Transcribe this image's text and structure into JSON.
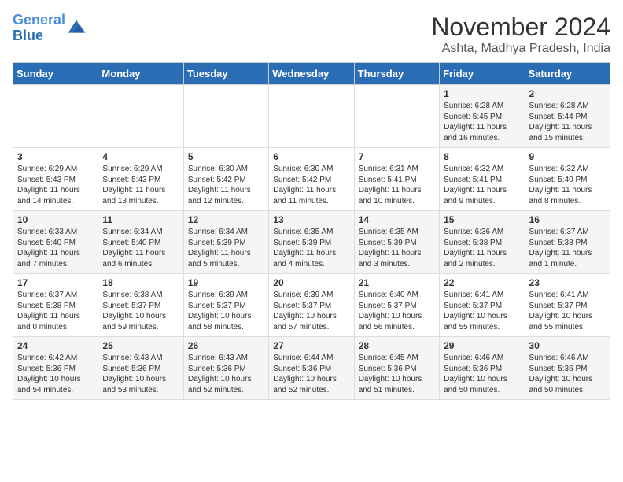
{
  "header": {
    "logo_line1": "General",
    "logo_line2": "Blue",
    "month_title": "November 2024",
    "location": "Ashta, Madhya Pradesh, India"
  },
  "days_of_week": [
    "Sunday",
    "Monday",
    "Tuesday",
    "Wednesday",
    "Thursday",
    "Friday",
    "Saturday"
  ],
  "weeks": [
    [
      {
        "day": "",
        "content": ""
      },
      {
        "day": "",
        "content": ""
      },
      {
        "day": "",
        "content": ""
      },
      {
        "day": "",
        "content": ""
      },
      {
        "day": "",
        "content": ""
      },
      {
        "day": "1",
        "content": "Sunrise: 6:28 AM\nSunset: 5:45 PM\nDaylight: 11 hours and 16 minutes."
      },
      {
        "day": "2",
        "content": "Sunrise: 6:28 AM\nSunset: 5:44 PM\nDaylight: 11 hours and 15 minutes."
      }
    ],
    [
      {
        "day": "3",
        "content": "Sunrise: 6:29 AM\nSunset: 5:43 PM\nDaylight: 11 hours and 14 minutes."
      },
      {
        "day": "4",
        "content": "Sunrise: 6:29 AM\nSunset: 5:43 PM\nDaylight: 11 hours and 13 minutes."
      },
      {
        "day": "5",
        "content": "Sunrise: 6:30 AM\nSunset: 5:42 PM\nDaylight: 11 hours and 12 minutes."
      },
      {
        "day": "6",
        "content": "Sunrise: 6:30 AM\nSunset: 5:42 PM\nDaylight: 11 hours and 11 minutes."
      },
      {
        "day": "7",
        "content": "Sunrise: 6:31 AM\nSunset: 5:41 PM\nDaylight: 11 hours and 10 minutes."
      },
      {
        "day": "8",
        "content": "Sunrise: 6:32 AM\nSunset: 5:41 PM\nDaylight: 11 hours and 9 minutes."
      },
      {
        "day": "9",
        "content": "Sunrise: 6:32 AM\nSunset: 5:40 PM\nDaylight: 11 hours and 8 minutes."
      }
    ],
    [
      {
        "day": "10",
        "content": "Sunrise: 6:33 AM\nSunset: 5:40 PM\nDaylight: 11 hours and 7 minutes."
      },
      {
        "day": "11",
        "content": "Sunrise: 6:34 AM\nSunset: 5:40 PM\nDaylight: 11 hours and 6 minutes."
      },
      {
        "day": "12",
        "content": "Sunrise: 6:34 AM\nSunset: 5:39 PM\nDaylight: 11 hours and 5 minutes."
      },
      {
        "day": "13",
        "content": "Sunrise: 6:35 AM\nSunset: 5:39 PM\nDaylight: 11 hours and 4 minutes."
      },
      {
        "day": "14",
        "content": "Sunrise: 6:35 AM\nSunset: 5:39 PM\nDaylight: 11 hours and 3 minutes."
      },
      {
        "day": "15",
        "content": "Sunrise: 6:36 AM\nSunset: 5:38 PM\nDaylight: 11 hours and 2 minutes."
      },
      {
        "day": "16",
        "content": "Sunrise: 6:37 AM\nSunset: 5:38 PM\nDaylight: 11 hours and 1 minute."
      }
    ],
    [
      {
        "day": "17",
        "content": "Sunrise: 6:37 AM\nSunset: 5:38 PM\nDaylight: 11 hours and 0 minutes."
      },
      {
        "day": "18",
        "content": "Sunrise: 6:38 AM\nSunset: 5:37 PM\nDaylight: 10 hours and 59 minutes."
      },
      {
        "day": "19",
        "content": "Sunrise: 6:39 AM\nSunset: 5:37 PM\nDaylight: 10 hours and 58 minutes."
      },
      {
        "day": "20",
        "content": "Sunrise: 6:39 AM\nSunset: 5:37 PM\nDaylight: 10 hours and 57 minutes."
      },
      {
        "day": "21",
        "content": "Sunrise: 6:40 AM\nSunset: 5:37 PM\nDaylight: 10 hours and 56 minutes."
      },
      {
        "day": "22",
        "content": "Sunrise: 6:41 AM\nSunset: 5:37 PM\nDaylight: 10 hours and 55 minutes."
      },
      {
        "day": "23",
        "content": "Sunrise: 6:41 AM\nSunset: 5:37 PM\nDaylight: 10 hours and 55 minutes."
      }
    ],
    [
      {
        "day": "24",
        "content": "Sunrise: 6:42 AM\nSunset: 5:36 PM\nDaylight: 10 hours and 54 minutes."
      },
      {
        "day": "25",
        "content": "Sunrise: 6:43 AM\nSunset: 5:36 PM\nDaylight: 10 hours and 53 minutes."
      },
      {
        "day": "26",
        "content": "Sunrise: 6:43 AM\nSunset: 5:36 PM\nDaylight: 10 hours and 52 minutes."
      },
      {
        "day": "27",
        "content": "Sunrise: 6:44 AM\nSunset: 5:36 PM\nDaylight: 10 hours and 52 minutes."
      },
      {
        "day": "28",
        "content": "Sunrise: 6:45 AM\nSunset: 5:36 PM\nDaylight: 10 hours and 51 minutes."
      },
      {
        "day": "29",
        "content": "Sunrise: 6:46 AM\nSunset: 5:36 PM\nDaylight: 10 hours and 50 minutes."
      },
      {
        "day": "30",
        "content": "Sunrise: 6:46 AM\nSunset: 5:36 PM\nDaylight: 10 hours and 50 minutes."
      }
    ]
  ]
}
